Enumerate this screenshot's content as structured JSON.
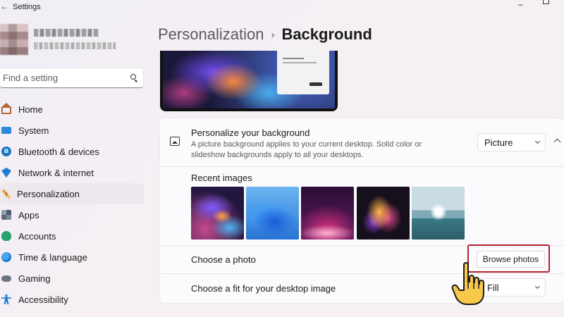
{
  "window": {
    "title": "Settings",
    "back_glyph": "←",
    "minimize_glyph": "–"
  },
  "search": {
    "placeholder": "Find a setting"
  },
  "sidebar": {
    "items": [
      {
        "label": "Home",
        "icon": "home-icon"
      },
      {
        "label": "System",
        "icon": "monitor-icon"
      },
      {
        "label": "Bluetooth & devices",
        "icon": "bluetooth-icon"
      },
      {
        "label": "Network & internet",
        "icon": "wifi-icon"
      },
      {
        "label": "Personalization",
        "icon": "paintbrush-icon",
        "active": true
      },
      {
        "label": "Apps",
        "icon": "apps-icon"
      },
      {
        "label": "Accounts",
        "icon": "person-icon"
      },
      {
        "label": "Time & language",
        "icon": "globe-clock-icon"
      },
      {
        "label": "Gaming",
        "icon": "controller-icon"
      },
      {
        "label": "Accessibility",
        "icon": "accessibility-icon"
      }
    ]
  },
  "breadcrumb": {
    "parent": "Personalization",
    "separator": "›",
    "current": "Background"
  },
  "background": {
    "title": "Personalize your background",
    "description": "A picture background applies to your current desktop. Solid color or slideshow backgrounds apply to all your desktops.",
    "type_value": "Picture",
    "bt_glyph": "ʙ"
  },
  "recent": {
    "label": "Recent images",
    "images": [
      "space-nebula",
      "blue-bloom",
      "purple-glow",
      "abstract-flower",
      "lake-sunrise"
    ]
  },
  "photo": {
    "label": "Choose a photo",
    "button": "Browse photos"
  },
  "fit": {
    "label": "Choose a fit for your desktop image",
    "value": "Fill"
  },
  "colors": {
    "highlight": "#b2222e",
    "active_nav": "#ede8ee"
  }
}
